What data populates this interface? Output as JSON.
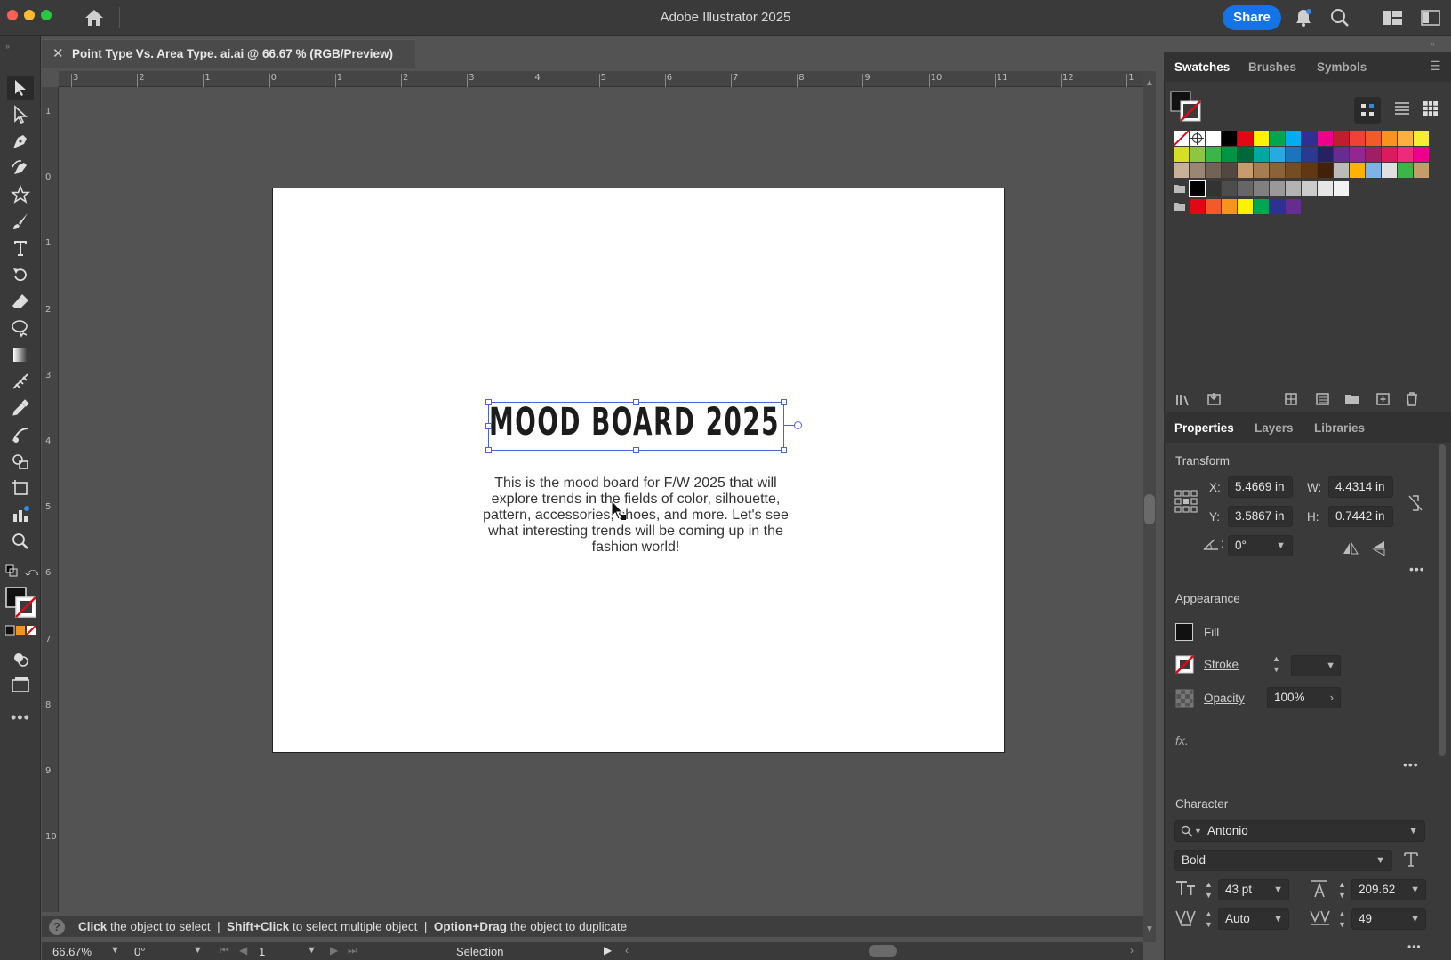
{
  "app": {
    "title": "Adobe Illustrator 2025",
    "share_label": "Share"
  },
  "document": {
    "tab_title": "Point Type Vs. Area Type. ai.ai @ 66.67 % (RGB/Preview)",
    "close": "✕"
  },
  "ruler": {
    "h_labels": [
      "3",
      "2",
      "1",
      "0",
      "1",
      "2",
      "3",
      "4",
      "5",
      "6",
      "7",
      "8",
      "9",
      "10",
      "11",
      "12",
      "1"
    ],
    "v_labels": [
      "1",
      "0",
      "1",
      "2",
      "3",
      "4",
      "5",
      "6",
      "7",
      "8",
      "9",
      "10"
    ]
  },
  "artboard": {
    "headline": "MOOD BOARD 2025",
    "body": "This is the mood board for F/W 2025 that will explore trends in the fields of color, silhouette, pattern, accessories, shoes, and more. Let's see what interesting trends will be coming up in the fashion world!"
  },
  "status": {
    "hint_parts": [
      {
        "b": "Click",
        "t": " the object to select  |  "
      },
      {
        "b": "Shift+Click",
        "t": " to select multiple object  |  "
      },
      {
        "b": "Option+Drag",
        "t": " the object to duplicate"
      }
    ],
    "zoom": "66.67%",
    "rotation": "0°",
    "artboard_num": "1",
    "tool_mode": "Selection"
  },
  "panels": {
    "top_tabs": [
      "Swatches",
      "Brushes",
      "Symbols"
    ],
    "bottom_tabs": [
      "Properties",
      "Layers",
      "Libraries"
    ],
    "transform": {
      "title": "Transform",
      "x_label": "X:",
      "x": "5.4669 in",
      "w_label": "W:",
      "w": "4.4314 in",
      "y_label": "Y:",
      "y": "3.5867 in",
      "h_label": "H:",
      "h": "0.7442 in",
      "angle": "0°"
    },
    "appearance": {
      "title": "Appearance",
      "fill": "Fill",
      "stroke": "Stroke",
      "opacity": "Opacity",
      "opacity_value": "100%",
      "fx": "fx."
    },
    "character": {
      "title": "Character",
      "font": "Antonio",
      "style": "Bold",
      "size": "43 pt",
      "leading": "209.62",
      "kerning": "Auto",
      "tracking": "49"
    }
  },
  "swatches": {
    "row1": [
      "#ffffff",
      "#ffffff",
      "#ffffff",
      "#000000",
      "#e30613",
      "#fff200",
      "#00a651",
      "#00aeef",
      "#2e3192",
      "#ec008c",
      "#be1e2d",
      "#ef4136",
      "#f15a29",
      "#f7941d",
      "#fbb040",
      "#f9ed32"
    ],
    "row2": [
      "#d7df23",
      "#8dc63f",
      "#39b54a",
      "#009444",
      "#006838",
      "#00a99d",
      "#27aae1",
      "#1c75bc",
      "#2b3990",
      "#262262",
      "#662d91",
      "#92278f",
      "#9e1f63",
      "#da1c5c",
      "#ee2a7b",
      "#ec008c"
    ],
    "row3": [
      "#c7b299",
      "#998675",
      "#736357",
      "#534741",
      "#c69c6d",
      "#a67c52",
      "#8c6239",
      "#754c24",
      "#603813",
      "#42210b",
      "#bbbbbb",
      "#ffb300",
      "#7fb3e6",
      "#e0e0e0",
      "#39b54a",
      "#c69c6d"
    ],
    "row4": [
      "#000000",
      "#333333",
      "#4d4d4d",
      "#666666",
      "#808080",
      "#999999",
      "#b3b3b3",
      "#cccccc",
      "#e6e6e6",
      "#f2f2f2"
    ],
    "row5": [
      "#e30613",
      "#f15a29",
      "#f7941d",
      "#fff200",
      "#00a651",
      "#2e3192",
      "#662d91"
    ]
  }
}
